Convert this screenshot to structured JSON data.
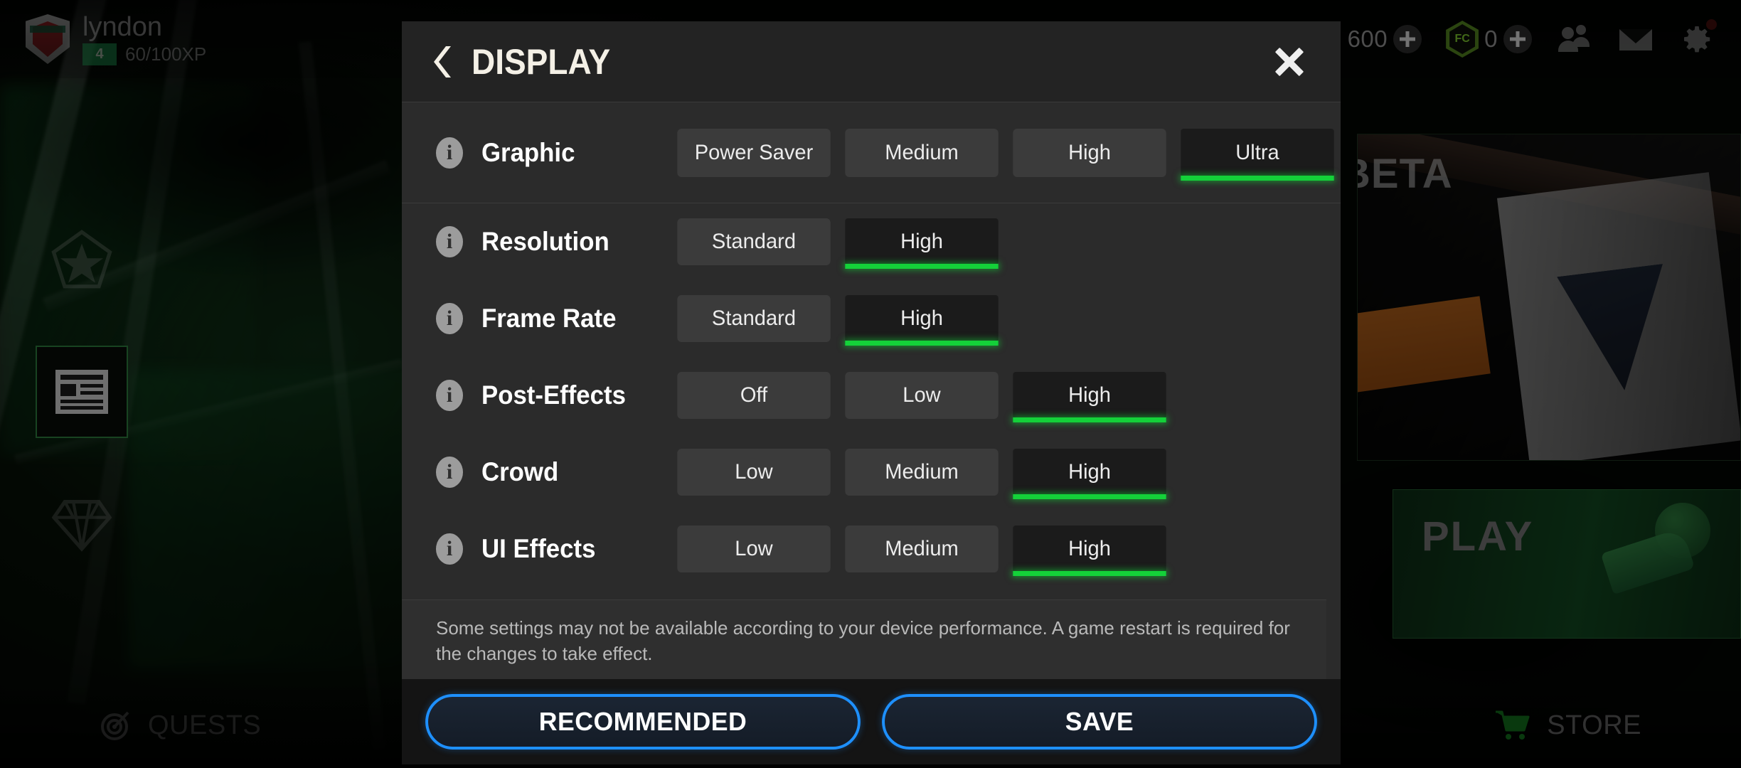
{
  "hud": {
    "player": {
      "name": "lyndon",
      "level": "4",
      "xp": "60/100XP",
      "crest_name": "liverpool-crest"
    },
    "currency": {
      "coins_value": "600",
      "coins_add_label": "+",
      "gems_value": "0",
      "gems_add_label": "+"
    },
    "icons": {
      "friends": "friends-icon",
      "mail": "mail-icon",
      "settings": "gear-icon"
    }
  },
  "left_rail": {
    "items": [
      {
        "name": "pentagon-star-icon",
        "selected": false
      },
      {
        "name": "news-icon",
        "selected": true
      },
      {
        "name": "diamond-icon",
        "selected": false
      }
    ]
  },
  "cards": {
    "beta": {
      "title": "BETA",
      "logo": "ea-sports-fc-logo"
    },
    "play": {
      "title": "PLAY"
    }
  },
  "bottom_nav": {
    "quests_label": "QUESTS",
    "quests_icon": "target-icon",
    "store_label": "STORE",
    "store_icon": "cart-icon"
  },
  "modal": {
    "title": "DISPLAY",
    "back_label": "‹",
    "close_label": "✕",
    "note": "Some settings may not be available according to your device performance. A game restart is required for the changes to take effect.",
    "buttons": {
      "recommended": "RECOMMENDED",
      "save": "SAVE"
    },
    "accent_green": "#14d139",
    "accent_blue": "#1e90ff",
    "settings": [
      {
        "label": "Graphic",
        "info": "i",
        "options": [
          {
            "label": "Power Saver",
            "selected": false
          },
          {
            "label": "Medium",
            "selected": false
          },
          {
            "label": "High",
            "selected": false
          },
          {
            "label": "Ultra",
            "selected": true
          }
        ]
      },
      {
        "label": "Resolution",
        "info": "i",
        "options": [
          {
            "label": "Standard",
            "selected": false
          },
          {
            "label": "High",
            "selected": true
          }
        ]
      },
      {
        "label": "Frame Rate",
        "info": "i",
        "options": [
          {
            "label": "Standard",
            "selected": false
          },
          {
            "label": "High",
            "selected": true
          }
        ]
      },
      {
        "label": "Post-Effects",
        "info": "i",
        "options": [
          {
            "label": "Off",
            "selected": false
          },
          {
            "label": "Low",
            "selected": false
          },
          {
            "label": "High",
            "selected": true
          }
        ]
      },
      {
        "label": "Crowd",
        "info": "i",
        "options": [
          {
            "label": "Low",
            "selected": false
          },
          {
            "label": "Medium",
            "selected": false
          },
          {
            "label": "High",
            "selected": true
          }
        ]
      },
      {
        "label": "UI Effects",
        "info": "i",
        "options": [
          {
            "label": "Low",
            "selected": false
          },
          {
            "label": "Medium",
            "selected": false
          },
          {
            "label": "High",
            "selected": true
          }
        ]
      }
    ]
  }
}
